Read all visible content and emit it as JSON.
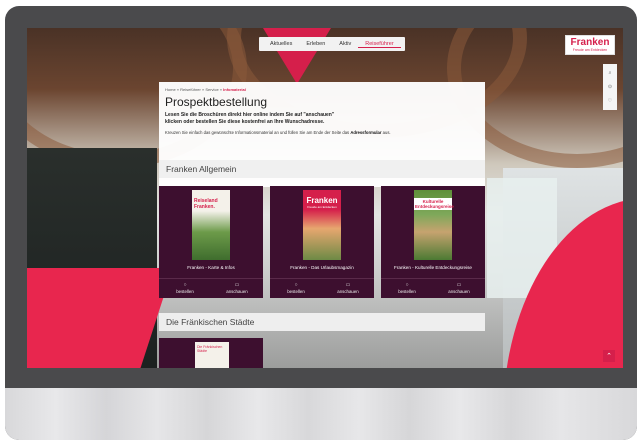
{
  "nav": {
    "items": [
      "Aktuelles",
      "Erleben",
      "Aktiv",
      "Reiseführer"
    ],
    "active_index": 3
  },
  "logo": {
    "brand": "Franken",
    "tagline": "Freude am Entdecken"
  },
  "sidebar": {
    "items": [
      "Suche",
      "Karte",
      "Favoriten"
    ]
  },
  "breadcrumb": {
    "home": "Home",
    "sep": "»",
    "level1": "Reiseführer",
    "level2": "Service",
    "current": "Infomaterial"
  },
  "page": {
    "title": "Prospektbestellung",
    "lead_line1": "Lesen Sie die Broschüren direkt hier online indem Sie auf \"anschauen\"",
    "lead_line2": "klicken oder bestellen Sie diese kostenfrei an Ihre Wunschadresse.",
    "info_text": "Kreuzen Sie einfach das gewünschte Informationsmaterial an und füllen Sie am Ende der Seite das",
    "info_link": "Adressformular",
    "info_end": "aus."
  },
  "sections": {
    "s1": "Franken Allgemein",
    "s2": "Die Fränkischen Städte"
  },
  "cards": [
    {
      "title": "Franken - Karte & Infos",
      "cover_label": "Reiseland Franken.",
      "order": "bestellen",
      "view": "anschauen"
    },
    {
      "title": "Franken - Das Urlaubsmagazin",
      "cover_label": "Franken",
      "cover_sub": "Freude am Entdecken",
      "order": "bestellen",
      "view": "anschauen"
    },
    {
      "title": "Franken - Kulturelle Entdeckungsreise",
      "cover_label": "Kulturelle Entdeckungsreise",
      "order": "bestellen",
      "view": "anschauen"
    }
  ],
  "card_partial": {
    "cover_label": "Die Fränkischen Städte"
  },
  "colors": {
    "accent": "#d51f4b",
    "card_bg": "#3d0f2f"
  }
}
